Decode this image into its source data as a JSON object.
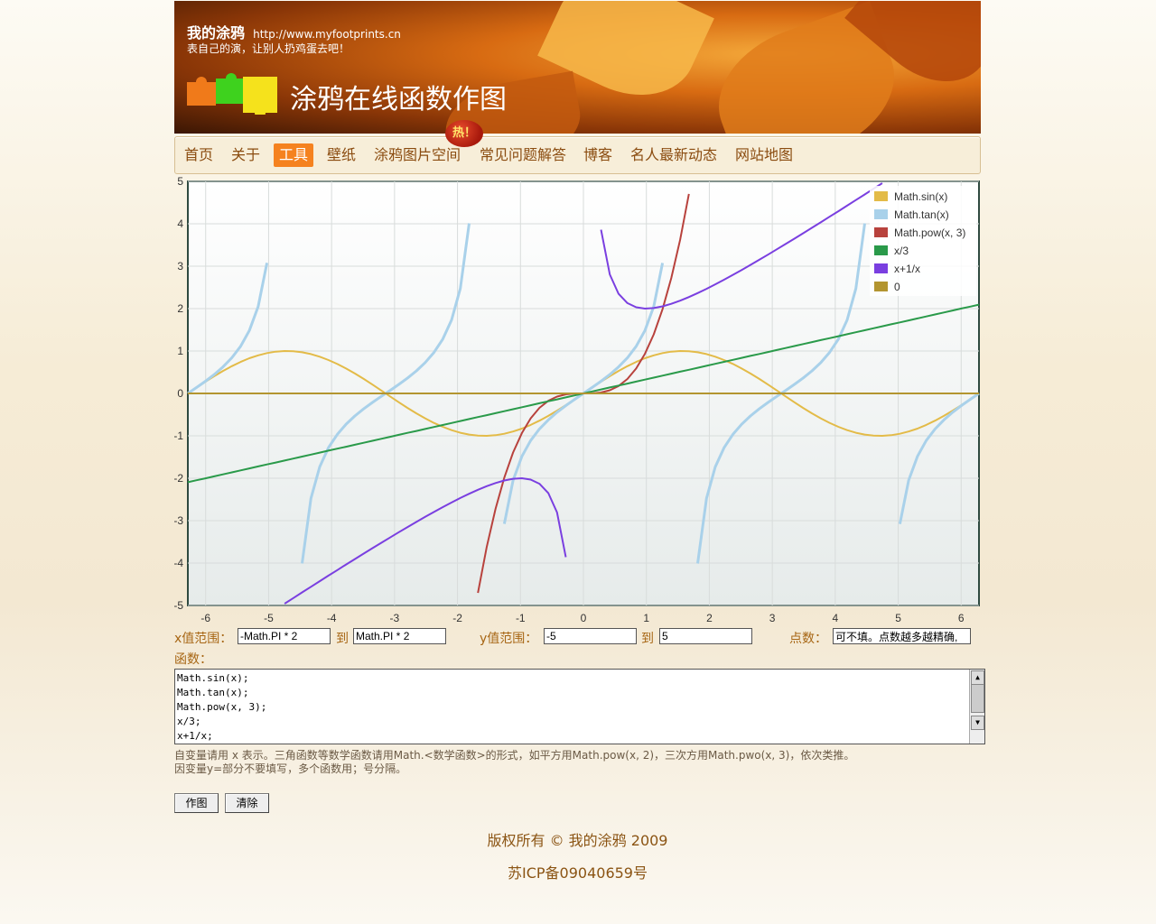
{
  "header": {
    "site_name": "我的涂鸦",
    "site_url": "http://www.myfootprints.cn",
    "slogan": "表自己的演，让别人扔鸡蛋去吧！",
    "page_title": "涂鸦在线函数作图"
  },
  "nav": {
    "items": [
      "首页",
      "关于",
      "工具",
      "壁纸",
      "涂鸦图片空间",
      "常见问题解答",
      "博客",
      "名人最新动态",
      "网站地图"
    ],
    "active": "工具",
    "hot_badge": "热！"
  },
  "chart_data": {
    "type": "line",
    "xlim": [
      -6.283,
      6.283
    ],
    "ylim": [
      -5,
      5
    ],
    "x_ticks": [
      -6,
      -5,
      -4,
      -3,
      -2,
      -1,
      0,
      1,
      2,
      3,
      4,
      5,
      6
    ],
    "y_ticks": [
      5,
      4,
      3,
      2,
      1,
      0,
      -1,
      -2,
      -3,
      -4,
      -5
    ],
    "grid": true,
    "legend_placement": "top-right",
    "series": [
      {
        "name": "Math.sin(x)",
        "color": "#e3bb48"
      },
      {
        "name": "Math.tan(x)",
        "color": "#a9d1ea"
      },
      {
        "name": "Math.pow(x, 3)",
        "color": "#b8423d"
      },
      {
        "name": "x/3",
        "color": "#2a9a4a"
      },
      {
        "name": "x+1/x",
        "color": "#7a3fe0"
      },
      {
        "name": "0",
        "color": "#b39530"
      }
    ]
  },
  "controls": {
    "x_range_label": "x值范围：",
    "x_from": "-Math.PI * 2",
    "to_label": "到",
    "x_to": "Math.PI * 2",
    "y_range_label": "y值范围：",
    "y_from": "-5",
    "y_to": "5",
    "points_label": "点数：",
    "points_placeholder": "可不填。点数越多越精确,"
  },
  "functions": {
    "label": "函数：",
    "lines": [
      "Math.sin(x);",
      "Math.tan(x);",
      "Math.pow(x, 3);",
      "x/3;",
      "x+1/x;"
    ]
  },
  "hint": {
    "line1": "自变量请用 x 表示。三角函数等数学函数请用Math.<数学函数>的形式，如平方用Math.pow(x, 2)，三次方用Math.pwo(x, 3)，依次类推。",
    "line2": "因变量y=部分不要填写，多个函数用；号分隔。"
  },
  "buttons": {
    "plot": "作图",
    "clear": "清除"
  },
  "footer": {
    "copyright": "版权所有 © 我的涂鸦 2009",
    "icp": "苏ICP备09040659号"
  }
}
